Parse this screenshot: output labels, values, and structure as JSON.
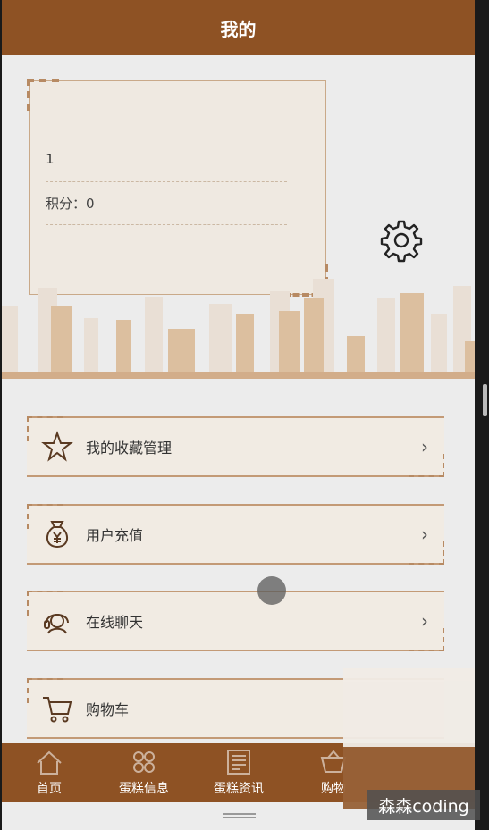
{
  "header": {
    "title": "我的"
  },
  "profile": {
    "username": "1",
    "points_label": "积分：0"
  },
  "settings": {
    "icon": "gear-icon"
  },
  "menu": [
    {
      "label": "我的收藏管理",
      "icon": "star-icon"
    },
    {
      "label": "用户充值",
      "icon": "money-bag-icon"
    },
    {
      "label": "在线聊天",
      "icon": "headset-icon"
    },
    {
      "label": "购物车",
      "icon": "cart-icon"
    }
  ],
  "tabs": [
    {
      "label": "首页",
      "icon": "home-icon"
    },
    {
      "label": "蛋糕信息",
      "icon": "grid-icon"
    },
    {
      "label": "蛋糕资讯",
      "icon": "news-icon"
    },
    {
      "label": "购物",
      "icon": "basket-icon"
    }
  ],
  "watermark": "森森coding",
  "colors": {
    "brand": "#8e5224",
    "card": "#efe9e1",
    "accent": "#b78a63"
  }
}
